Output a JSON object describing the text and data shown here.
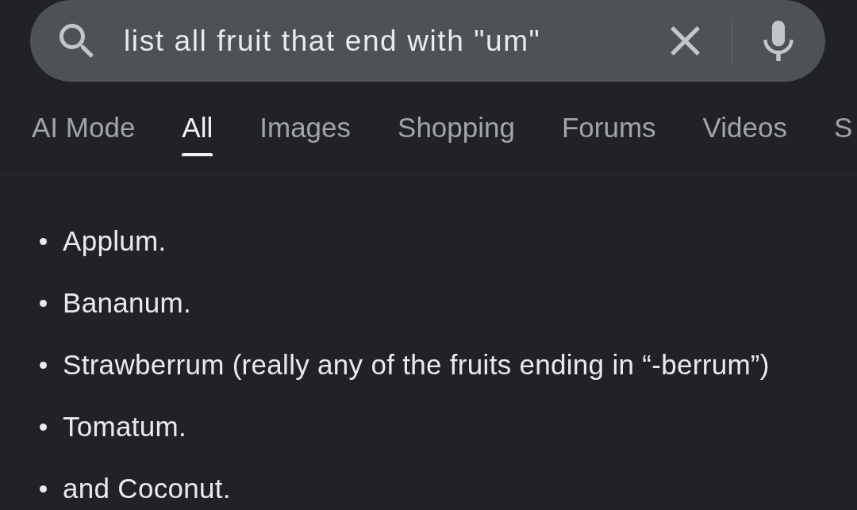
{
  "search": {
    "query": "list all fruit that end with \"um\""
  },
  "tabs": [
    {
      "label": "AI Mode",
      "selected": false
    },
    {
      "label": "All",
      "selected": true
    },
    {
      "label": "Images",
      "selected": false
    },
    {
      "label": "Shopping",
      "selected": false
    },
    {
      "label": "Forums",
      "selected": false
    },
    {
      "label": "Videos",
      "selected": false
    },
    {
      "label": "S",
      "selected": false
    }
  ],
  "results": {
    "items": [
      "Applum.",
      "Bananum.",
      "Strawberrum (really any of the fruits ending in “-berrum”)",
      "Tomatum.",
      "and Coconut."
    ]
  }
}
